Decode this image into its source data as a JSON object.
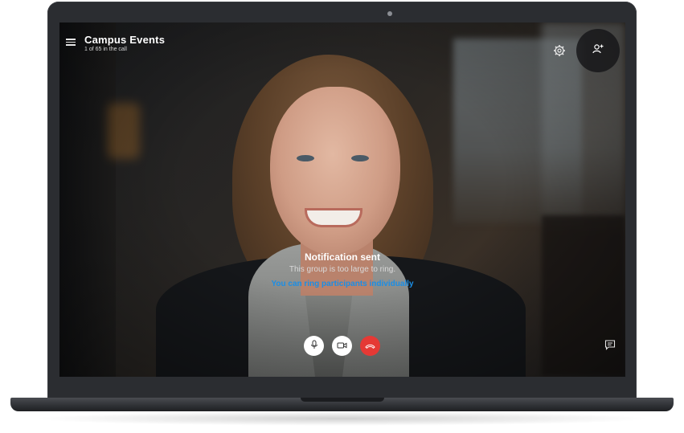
{
  "call": {
    "title": "Campus Events",
    "participants": "1 of 65 in the call"
  },
  "notification": {
    "title": "Notification sent",
    "body": "This group is too large to ring.",
    "link": "You can ring participants individually"
  },
  "icons": {
    "menu": "hamburger-menu-icon",
    "settings": "gear-icon",
    "add_people": "add-person-icon",
    "mic": "microphone-icon",
    "video": "video-camera-icon",
    "hangup": "end-call-icon",
    "chat": "chat-icon"
  },
  "colors": {
    "accent_link": "#1a8ee6",
    "hangup": "#e53935",
    "device_frame": "#2b2d31"
  }
}
